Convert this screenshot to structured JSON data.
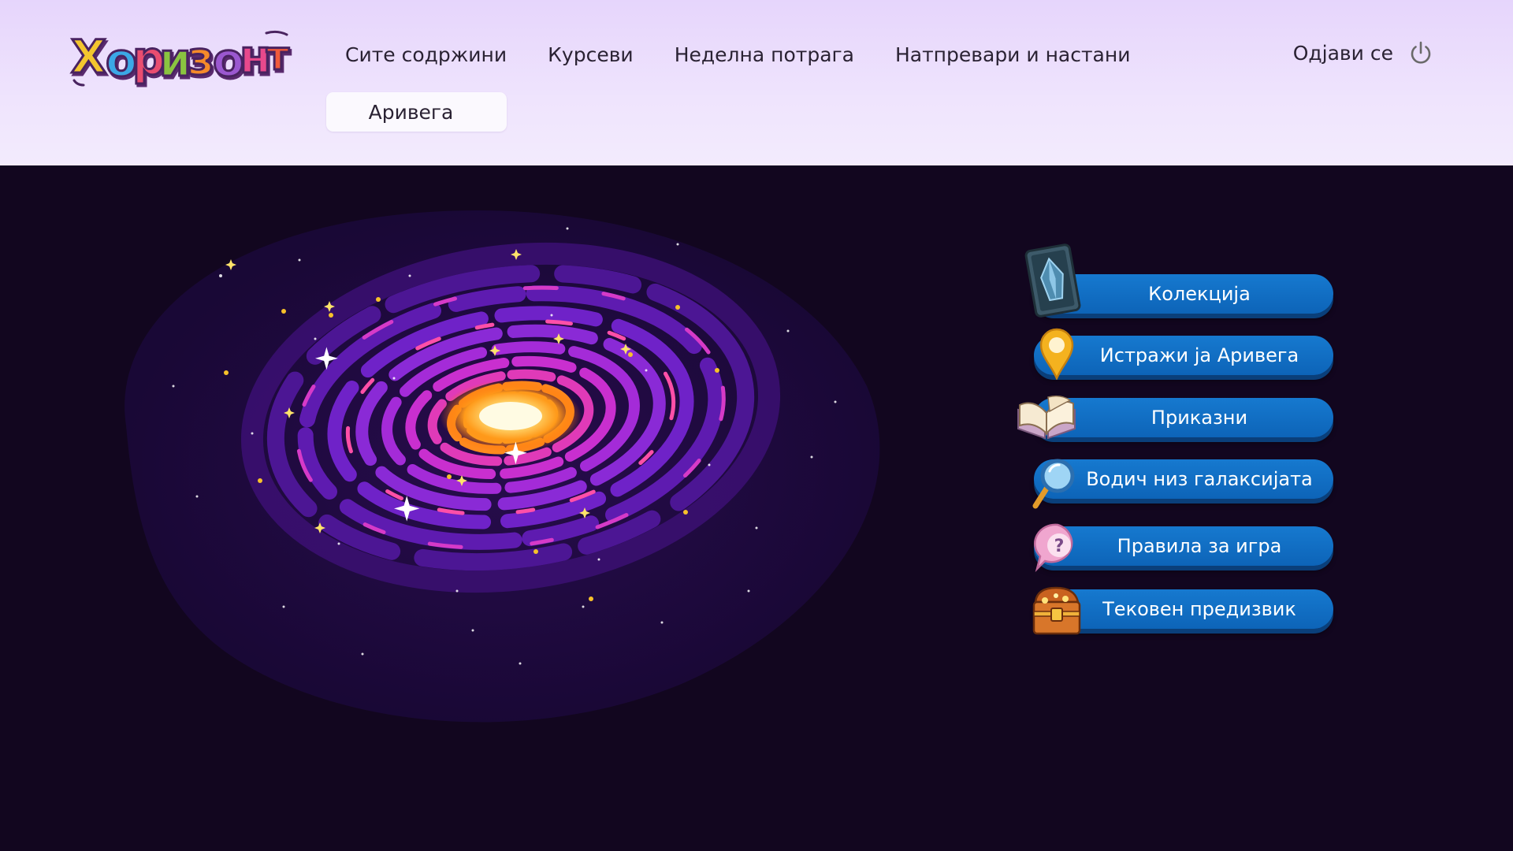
{
  "brand": {
    "logo_text": "Хоризонт"
  },
  "nav": {
    "items": [
      {
        "label": "Сите содржини"
      },
      {
        "label": "Курсеви"
      },
      {
        "label": "Неделна потрага"
      },
      {
        "label": "Натпревари и настани"
      }
    ],
    "active_subtab": "Аривега",
    "logout_label": "Одјави се"
  },
  "menu": {
    "items": [
      {
        "label": "Колекција",
        "icon": "crystal-card-icon"
      },
      {
        "label": "Истражи ја Аривега",
        "icon": "map-pin-icon"
      },
      {
        "label": "Приказни",
        "icon": "open-book-icon"
      },
      {
        "label": "Водич низ галаксијата",
        "icon": "magnifier-icon"
      },
      {
        "label": "Правила за игра",
        "icon": "question-bubble-icon"
      },
      {
        "label": "Тековен предизвик",
        "icon": "treasure-chest-icon"
      }
    ]
  },
  "colors": {
    "header_bg": "#e9dbfc",
    "page_bg": "#12061f",
    "button_blue": "#1370c4",
    "text_dark": "#2a2233"
  }
}
